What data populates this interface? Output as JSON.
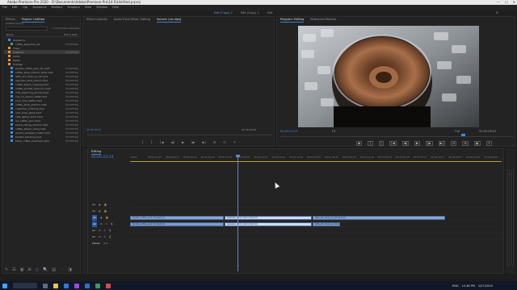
{
  "window": {
    "title": "Adobe Premiere Pro 2020 - D:\\Documents\\Adobe\\Premiere Pro\\14.0\\Untitled.prproj",
    "controls": [
      "—",
      "☐",
      "✕"
    ]
  },
  "menu": [
    "File",
    "Edit",
    "Clip",
    "Sequence",
    "Markers",
    "Graphics",
    "View",
    "Window",
    "Help"
  ],
  "workspaces": [
    "Edit (Copy) 2",
    "Edit (Copy) 1",
    "Edit"
  ],
  "project_panel": {
    "tabs": [
      "Effects",
      "Project: Untitled"
    ],
    "path": "Untitled.prproj",
    "search_placeholder": "",
    "item_count": "1 of 22 items selected",
    "columns": [
      "Name",
      "Frame Rate"
    ],
    "items": [
      {
        "name": "Sequence",
        "color": "#4a8ad8",
        "dur": "",
        "indent": 1
      },
      {
        "name": "coffee_sequence_01",
        "color": "#3aa776",
        "dur": "23.976 fps",
        "indent": 2
      },
      {
        "name": "Titles",
        "color": "#e59536",
        "dur": "",
        "indent": 1
      },
      {
        "name": "Graphics",
        "color": "#e59536",
        "dur": "23.976 fps",
        "indent": 1,
        "selected": true
      },
      {
        "name": "Audio",
        "color": "#e59536",
        "dur": "",
        "indent": 1
      },
      {
        "name": "Media",
        "color": "#e59536",
        "dur": "",
        "indent": 1
      },
      {
        "name": "Footage",
        "color": "#e59536",
        "dur": "",
        "indent": 1
      },
      {
        "name": "barista_coffee_pour_01.mp4",
        "color": "#4a8ad8",
        "dur": "23.976 fps",
        "indent": 2
      },
      {
        "name": "coffee_shop_interior_wide.mp4",
        "color": "#4a8ad8",
        "dur": "23.976 fps",
        "indent": 2
      },
      {
        "name": "latte_art_close_up_02.mp4",
        "color": "#4a8ad8",
        "dur": "23.976 fps",
        "indent": 2
      },
      {
        "name": "espresso_shot_macro.mp4",
        "color": "#4a8ad8",
        "dur": "23.976 fps",
        "indent": 2
      },
      {
        "name": "coffee_beans_roasting.mp4",
        "color": "#4a8ad8",
        "dur": "23.976 fps",
        "indent": 2
      },
      {
        "name": "coffee_grinder_slow_mo.mp4",
        "color": "#4a8ad8",
        "dur": "23.976 fps",
        "indent": 2
      },
      {
        "name": "milk_steaming_pitcher.mp4",
        "color": "#4a8ad8",
        "dur": "23.976 fps",
        "indent": 2
      },
      {
        "name": "cup_on_saucer_table.mp4",
        "color": "#4a8ad8",
        "dur": "23.976 fps",
        "indent": 2
      },
      {
        "name": "pour_over_kettle.mp4",
        "color": "#4a8ad8",
        "dur": "23.976 fps",
        "indent": 2
      },
      {
        "name": "coffee_shop_exterior.mp4",
        "color": "#4a8ad8",
        "dur": "23.976 fps",
        "indent": 2
      },
      {
        "name": "customer_ordering.mp4",
        "color": "#4a8ad8",
        "dur": "23.976 fps",
        "indent": 2
      },
      {
        "name": "cold_brew_glass.mp4",
        "color": "#4a8ad8",
        "dur": "23.976 fps",
        "indent": 2
      },
      {
        "name": "cafe_laptop_work.mp4",
        "color": "#4a8ad8",
        "dur": "23.976 fps",
        "indent": 2
      },
      {
        "name": "ice_coffee_pour.mp4",
        "color": "#4a8ad8",
        "dur": "23.976 fps",
        "indent": 2
      },
      {
        "name": "beans_falling_slowmo.mp4",
        "color": "#4a8ad8",
        "dur": "23.976 fps",
        "indent": 2
      },
      {
        "name": "coffee_steam_rising.mp4",
        "color": "#4a8ad8",
        "dur": "23.976 fps",
        "indent": 2
      },
      {
        "name": "mocha_whipped_cream.mp4",
        "color": "#4a8ad8",
        "dur": "23.976 fps",
        "indent": 2
      },
      {
        "name": "barista_tamping.mp4",
        "color": "#4a8ad8",
        "dur": "23.976 fps",
        "indent": 2
      },
      {
        "name": "table_coffee_overhead.mp4",
        "color": "#4a8ad8",
        "dur": "23.976 fps",
        "indent": 2
      }
    ],
    "footer_icons": [
      "✎",
      "☰",
      "▦",
      "⊞",
      "○",
      "🔍",
      "▤",
      "🗀",
      "◨"
    ]
  },
  "source_panel": {
    "tabs": [
      "Effect Controls",
      "Audio Track Mixer: Editing",
      "Source: (no clips)"
    ],
    "timecode_in": "00:00:00:00",
    "timecode_out": "00:00:00:00",
    "controls": [
      "{",
      "}",
      "|◀",
      "◀|",
      "▶",
      "|▶",
      "▶|",
      "⊞",
      "⊟",
      "+"
    ]
  },
  "program_panel": {
    "tabs": [
      "Program: Editing",
      "Reference Monitor"
    ],
    "timecode": "00:00:23:14",
    "fit": "Fit",
    "full": "Full",
    "duration": "00:02:06:03",
    "controls": [
      "◆",
      "{",
      "}",
      "|◀",
      "◀|",
      "▶",
      "|▶",
      "▶|",
      "⊟",
      "⊞",
      "▣",
      "+"
    ]
  },
  "timeline": {
    "tab": "Editing",
    "timecode": "00:00:23:14",
    "ticks": [
      ":00:00",
      "00:00:14:23",
      "00:00:29:23",
      "00:00:44:22",
      "00:00:59:22",
      "00:01:14:22",
      "00:01:29:21",
      "00:01:44:21",
      "00:01:59:21",
      "00:02:14:20",
      "00:02:29:20",
      "00:02:44:19",
      "00:02:59:19",
      "00:03:14:18",
      "00:03:29:18",
      "00:03:44:18",
      "00:03:59:17",
      "00:04:14:17",
      "00:04:29:17",
      "00:04:44:16",
      "00:04:59:16"
    ],
    "video_tracks": [
      "V3",
      "V2",
      "V1"
    ],
    "audio_tracks": [
      "A1",
      "A2",
      "A3"
    ],
    "master": "Master",
    "master_value": "0.0",
    "clips_v1": [
      "barista_coffee_pour_01.mp4 [V]",
      "espresso_shot_macro.mp4 [V]",
      "latte_art_close_up_02.mp4 [V]"
    ],
    "clips_a1": [
      "barista_coffee_pour_01.mp4 [A]",
      "espresso_shot_macro.mp4 [A]",
      "latte_art_close_up_02.mp4 [A]"
    ]
  },
  "taskbar": {
    "time": "12:48 PM",
    "date": "1/27/2020",
    "lang": "ENG"
  },
  "colors": {
    "accent": "#3d8be0",
    "clip": "#8aa7cf",
    "work_area": "#b89a2e",
    "bin_orange": "#e59536"
  }
}
